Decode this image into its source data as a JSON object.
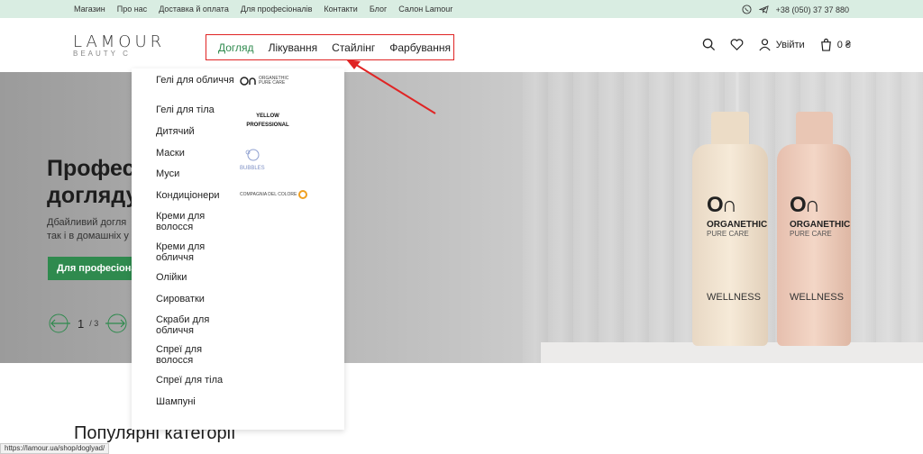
{
  "topbar": {
    "links": [
      "Магазин",
      "Про нас",
      "Доставка й оплата",
      "Для професіоналів",
      "Контакти",
      "Блог",
      "Салон Lamour"
    ],
    "phone": "+38 (050) 37 37 880"
  },
  "header": {
    "logo": "LAMOUR",
    "logo_sub": "BEAUTY C",
    "nav": [
      "Догляд",
      "Лікування",
      "Стайлінг",
      "Фарбування"
    ],
    "login": "Увійти",
    "cart": "0 ₴",
    "colors": {
      "accent": "#2f8a4e",
      "highlight": "#e02424"
    }
  },
  "hero": {
    "title_line1": "Професі",
    "title_line2": "догляду",
    "text_line1": "Дбайливий догля",
    "text_line2": "так і в домашніх у",
    "button": "Для професіона",
    "slide_current": "1",
    "slide_total": "/ 3",
    "bottle1": {
      "brand": "ORGANETHIC",
      "sub": "PURE CARE",
      "product": "WELLNESS"
    },
    "bottle2": {
      "brand": "ORGANETHIC",
      "sub": "PURE CARE",
      "product": "WELLNESS"
    }
  },
  "dropdown": {
    "items": [
      "Гелі для обличчя",
      "Гелі для тіла",
      "Дитячий",
      "Маски",
      "Муси",
      "Кондиціонери",
      "Креми для волосся",
      "Креми для обличчя",
      "Олійки",
      "Сироватки",
      "Скраби для обличчя",
      "Спреї для волосся",
      "Спреї для тіла",
      "Шампуні"
    ],
    "brands": [
      "ORGANETHIC PURE CARE",
      "YELLOW PROFESSIONAL",
      "BUBBLES",
      "COMPAGNIA DEL COLORE"
    ]
  },
  "section": {
    "title": "Популярні категорії"
  },
  "status_url": "https://lamour.ua/shop/doglyad/"
}
